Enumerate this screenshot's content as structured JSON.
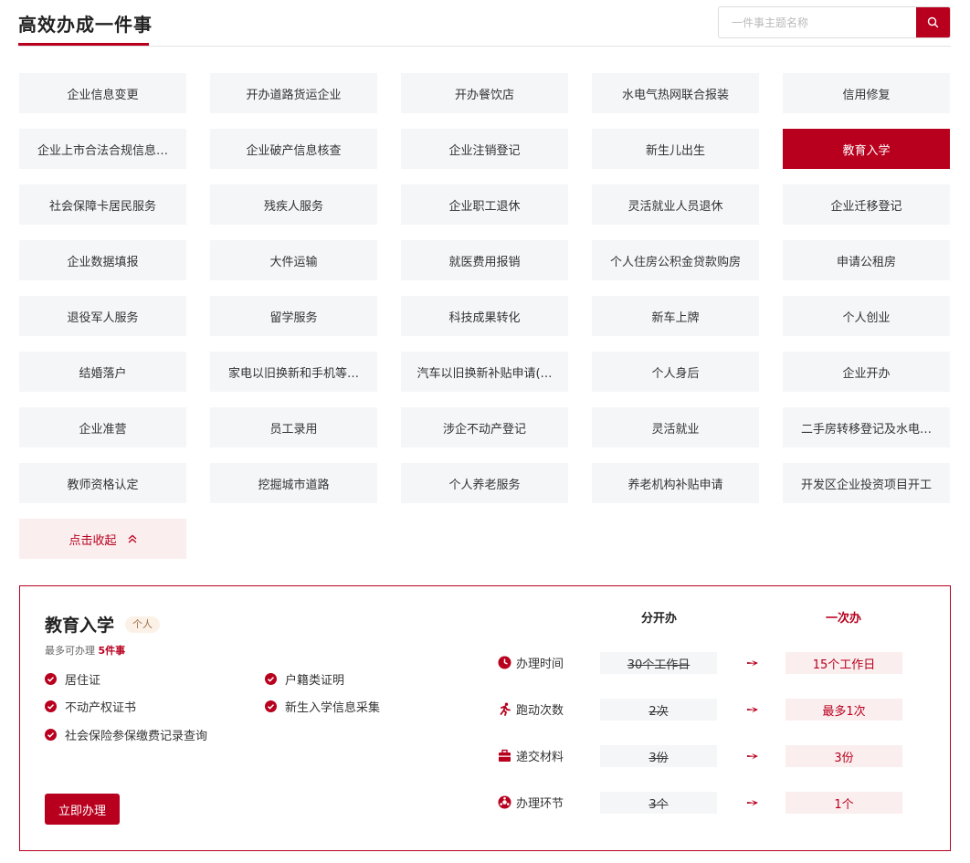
{
  "header": {
    "title": "高效办成一件事",
    "search_placeholder": "一件事主题名称"
  },
  "grid": {
    "items": [
      "企业信息变更",
      "开办道路货运企业",
      "开办餐饮店",
      "水电气热网联合报装",
      "信用修复",
      "企业上市合法合规信息…",
      "企业破产信息核查",
      "企业注销登记",
      "新生儿出生",
      "教育入学",
      "社会保障卡居民服务",
      "残疾人服务",
      "企业职工退休",
      "灵活就业人员退休",
      "企业迁移登记",
      "企业数据填报",
      "大件运输",
      "就医费用报销",
      "个人住房公积金贷款购房",
      "申请公租房",
      "退役军人服务",
      "留学服务",
      "科技成果转化",
      "新车上牌",
      "个人创业",
      "结婚落户",
      "家电以旧换新和手机等…",
      "汽车以旧换新补贴申请(…",
      "个人身后",
      "企业开办",
      "企业准营",
      "员工录用",
      "涉企不动产登记",
      "灵活就业",
      "二手房转移登记及水电…",
      "教师资格认定",
      "挖掘城市道路",
      "个人养老服务",
      "养老机构补贴申请",
      "开发区企业投资项目开工"
    ],
    "active_index": 9,
    "collapse_label": "点击收起"
  },
  "detail": {
    "title": "教育入学",
    "badge": "个人",
    "sub_prefix": "最多可办理",
    "sub_count": "5件事",
    "requirements": [
      "居住证",
      "户籍类证明",
      "不动产权证书",
      "新生入学信息采集",
      "社会保险参保缴费记录查询"
    ],
    "apply_label": "立即办理",
    "col_separate": "分开办",
    "col_once": "一次办",
    "metrics": [
      {
        "label": "办理时间",
        "icon": "clock-icon",
        "old": "30个工作日",
        "new": "15个工作日"
      },
      {
        "label": "跑动次数",
        "icon": "running-icon",
        "old": "2次",
        "new": "最多1次"
      },
      {
        "label": "递交材料",
        "icon": "briefcase-icon",
        "old": "3份",
        "new": "3份"
      },
      {
        "label": "办理环节",
        "icon": "steps-icon",
        "old": "3个",
        "new": "1个"
      }
    ]
  },
  "colors": {
    "accent": "#b8001e",
    "tile_bg": "#f5f6f8",
    "soft_red": "#fbeeee"
  }
}
